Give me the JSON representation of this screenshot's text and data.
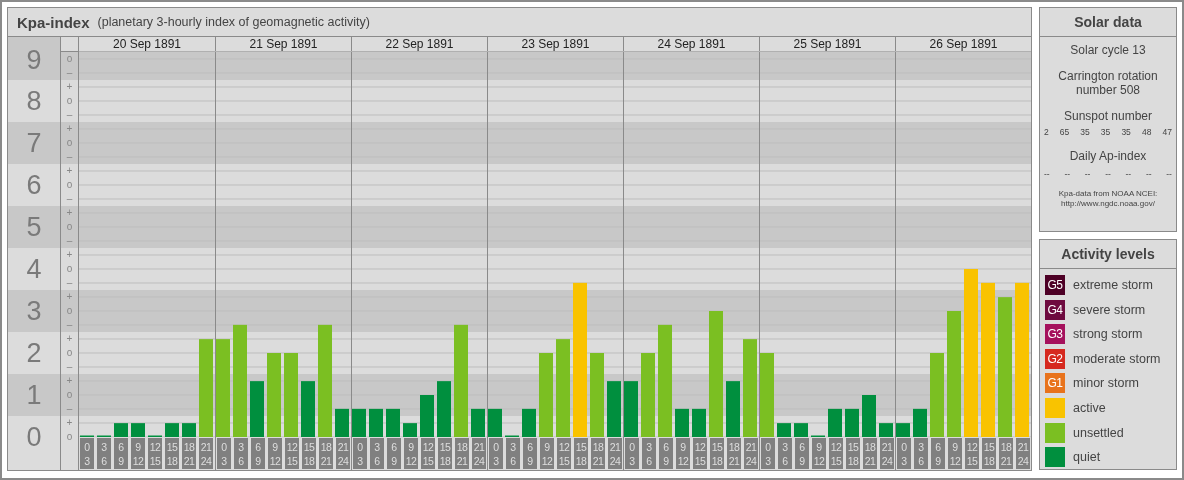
{
  "header": {
    "title": "Kpa-index",
    "subtitle": "(planetary 3-hourly index of geomagnetic activity)"
  },
  "levels": [
    {
      "marks": [
        "o",
        "–"
      ]
    },
    {
      "marks": [
        "+",
        "o",
        "–"
      ]
    },
    {
      "marks": [
        "+",
        "o",
        "–"
      ]
    },
    {
      "marks": [
        "+",
        "o",
        "–"
      ]
    },
    {
      "marks": [
        "+",
        "o",
        "–"
      ]
    },
    {
      "marks": [
        "+",
        "o",
        "–"
      ]
    },
    {
      "marks": [
        "+",
        "o",
        "–"
      ]
    },
    {
      "marks": [
        "+",
        "o",
        "–"
      ]
    },
    {
      "marks": [
        "+",
        "o",
        "–"
      ]
    },
    {
      "marks": [
        "+",
        "o"
      ]
    }
  ],
  "days": [
    {
      "date": "20 Sep 1891",
      "slots": [
        {
          "from": "0",
          "to": "3"
        },
        {
          "from": "3",
          "to": "6"
        },
        {
          "from": "6",
          "to": "9"
        },
        {
          "from": "9",
          "to": "12"
        },
        {
          "from": "12",
          "to": "15"
        },
        {
          "from": "15",
          "to": "18"
        },
        {
          "from": "18",
          "to": "21"
        },
        {
          "from": "21",
          "to": "24"
        }
      ]
    },
    {
      "date": "21 Sep 1891",
      "slots": [
        {
          "from": "0",
          "to": "3"
        },
        {
          "from": "3",
          "to": "6"
        },
        {
          "from": "6",
          "to": "9"
        },
        {
          "from": "9",
          "to": "12"
        },
        {
          "from": "12",
          "to": "15"
        },
        {
          "from": "15",
          "to": "18"
        },
        {
          "from": "18",
          "to": "21"
        },
        {
          "from": "21",
          "to": "24"
        }
      ]
    },
    {
      "date": "22 Sep 1891",
      "slots": [
        {
          "from": "0",
          "to": "3"
        },
        {
          "from": "3",
          "to": "6"
        },
        {
          "from": "6",
          "to": "9"
        },
        {
          "from": "9",
          "to": "12"
        },
        {
          "from": "12",
          "to": "15"
        },
        {
          "from": "15",
          "to": "18"
        },
        {
          "from": "18",
          "to": "21"
        },
        {
          "from": "21",
          "to": "24"
        }
      ]
    },
    {
      "date": "23 Sep 1891",
      "slots": [
        {
          "from": "0",
          "to": "3"
        },
        {
          "from": "3",
          "to": "6"
        },
        {
          "from": "6",
          "to": "9"
        },
        {
          "from": "9",
          "to": "12"
        },
        {
          "from": "12",
          "to": "15"
        },
        {
          "from": "15",
          "to": "18"
        },
        {
          "from": "18",
          "to": "21"
        },
        {
          "from": "21",
          "to": "24"
        }
      ]
    },
    {
      "date": "24 Sep 1891",
      "slots": [
        {
          "from": "0",
          "to": "3"
        },
        {
          "from": "3",
          "to": "6"
        },
        {
          "from": "6",
          "to": "9"
        },
        {
          "from": "9",
          "to": "12"
        },
        {
          "from": "12",
          "to": "15"
        },
        {
          "from": "15",
          "to": "18"
        },
        {
          "from": "18",
          "to": "21"
        },
        {
          "from": "21",
          "to": "24"
        }
      ]
    },
    {
      "date": "25 Sep 1891",
      "slots": [
        {
          "from": "0",
          "to": "3"
        },
        {
          "from": "3",
          "to": "6"
        },
        {
          "from": "6",
          "to": "9"
        },
        {
          "from": "9",
          "to": "12"
        },
        {
          "from": "12",
          "to": "15"
        },
        {
          "from": "15",
          "to": "18"
        },
        {
          "from": "18",
          "to": "21"
        },
        {
          "from": "21",
          "to": "24"
        }
      ]
    },
    {
      "date": "26 Sep 1891",
      "slots": [
        {
          "from": "0",
          "to": "3"
        },
        {
          "from": "3",
          "to": "6"
        },
        {
          "from": "6",
          "to": "9"
        },
        {
          "from": "9",
          "to": "12"
        },
        {
          "from": "12",
          "to": "15"
        },
        {
          "from": "15",
          "to": "18"
        },
        {
          "from": "18",
          "to": "21"
        },
        {
          "from": "21",
          "to": "24"
        }
      ]
    }
  ],
  "chart_data": {
    "type": "bar",
    "stacked": true,
    "grid": true,
    "bands": [
      {
        "axis": "y",
        "from": 0.5,
        "to": 1.5
      },
      {
        "axis": "y",
        "from": 2.5,
        "to": 3.5
      },
      {
        "axis": "y",
        "from": 4.5,
        "to": 5.5
      },
      {
        "axis": "y",
        "from": 6.5,
        "to": 7.5
      },
      {
        "axis": "y",
        "from": 8.5,
        "to": 9.5
      }
    ],
    "ylim": [
      0,
      9
    ],
    "yticks": [
      {
        "value": 0,
        "label": "0"
      },
      {
        "value": 1,
        "label": "1"
      },
      {
        "value": 2,
        "label": "2"
      },
      {
        "value": 3,
        "label": "3"
      },
      {
        "value": 4,
        "label": "4"
      },
      {
        "value": 5,
        "label": "5"
      },
      {
        "value": 6,
        "label": "6"
      },
      {
        "value": 7,
        "label": "7"
      },
      {
        "value": 8,
        "label": "8"
      },
      {
        "value": 9,
        "label": "9"
      }
    ],
    "series": [
      {
        "name": "active",
        "color": "#f9c300",
        "values": [
          null,
          null,
          null,
          null,
          null,
          null,
          null,
          null,
          null,
          null,
          null,
          null,
          null,
          null,
          null,
          null,
          null,
          null,
          null,
          null,
          null,
          null,
          null,
          null,
          null,
          null,
          null,
          null,
          null,
          3.67,
          null,
          null,
          null,
          null,
          null,
          null,
          null,
          null,
          null,
          null,
          null,
          null,
          null,
          null,
          null,
          null,
          null,
          null,
          null,
          null,
          null,
          null,
          4,
          3.67,
          null,
          3.67
        ]
      },
      {
        "name": "unsettled",
        "color": "#7bbf22",
        "values": [
          null,
          null,
          null,
          null,
          null,
          null,
          null,
          2.33,
          2.33,
          2.67,
          null,
          2,
          2,
          null,
          2.67,
          null,
          null,
          null,
          null,
          null,
          null,
          null,
          2.67,
          null,
          null,
          null,
          null,
          2,
          2.33,
          null,
          2,
          null,
          null,
          2,
          2.67,
          null,
          null,
          3,
          null,
          2.33,
          2,
          null,
          null,
          null,
          null,
          null,
          null,
          null,
          null,
          null,
          2,
          3,
          null,
          null,
          3.33,
          null
        ]
      },
      {
        "name": "quiet",
        "color": "#008f3e",
        "values": [
          0,
          0,
          0.33,
          0.33,
          0,
          0.33,
          0.33,
          null,
          null,
          null,
          1.33,
          null,
          null,
          1.33,
          null,
          0.67,
          0.67,
          0.67,
          0.67,
          0.33,
          1,
          1.33,
          null,
          0.67,
          0.67,
          0,
          0.67,
          null,
          null,
          null,
          null,
          1.33,
          1.33,
          null,
          null,
          0.67,
          0.67,
          null,
          1.33,
          null,
          null,
          0.33,
          0.33,
          0,
          0.67,
          0.67,
          1,
          0.33,
          0.33,
          0.67,
          null,
          null,
          null,
          null,
          null,
          null
        ]
      }
    ]
  },
  "solar_data": {
    "title": "Solar data",
    "cycle": "Solar cycle 13",
    "rotation": "Carrington rotation number 508",
    "sunspot_title": "Sunspot number",
    "sunspot_numbers": [
      "2",
      "65",
      "35",
      "35",
      "35",
      "48",
      "47"
    ],
    "ap_title": "Daily Ap-index",
    "ap_values": [
      "--",
      "--",
      "--",
      "--",
      "--",
      "--",
      "--"
    ],
    "source": "Kpa-data from NOAA NCEI:",
    "source_url": "http://www.ngdc.noaa.gov/"
  },
  "activity_levels": {
    "title": "Activity levels",
    "items": [
      {
        "code": "G5",
        "label": "extreme storm",
        "color": "#4d0025"
      },
      {
        "code": "G4",
        "label": "severe storm",
        "color": "#6e0a3f"
      },
      {
        "code": "G3",
        "label": "strong storm",
        "color": "#a5115c"
      },
      {
        "code": "G2",
        "label": "moderate storm",
        "color": "#d6291f"
      },
      {
        "code": "G1",
        "label": "minor storm",
        "color": "#e8731c"
      }
    ]
  }
}
